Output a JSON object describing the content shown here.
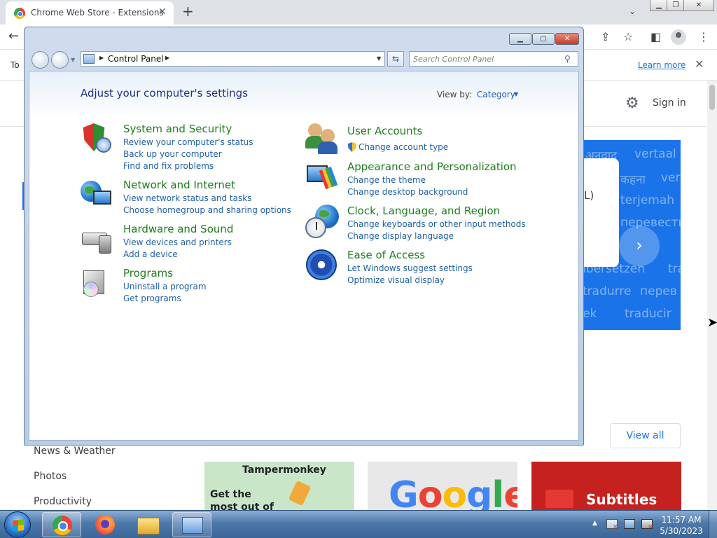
{
  "browser": {
    "tab_title": "Chrome Web Store - Extensions",
    "tab_close": "✕",
    "new_tab": "+",
    "infobar_text": "To",
    "learn_more": "Learn more",
    "sign_in": "Sign in",
    "banner_words": [
      "अनुवाद",
      "vertaal",
      "कहना",
      "ver",
      "terjemah",
      "перевести",
      "ubersetzen",
      "tra",
      "tradurre",
      "перев",
      "ek",
      "traducir"
    ],
    "banner_card_text": "L)",
    "sidebar_items": [
      "News & Weather",
      "Photos",
      "Productivity"
    ],
    "view_all": "View all",
    "tiles": {
      "tampermonkey_title": "Tampermonkey",
      "tampermonkey_sub": "Get the most out of every",
      "google_logo": "Google",
      "subtitles_title": "Subtitles"
    }
  },
  "control_panel": {
    "address_text": "Control Panel",
    "search_placeholder": "Search Control Panel",
    "heading": "Adjust your computer's settings",
    "view_by_label": "View by:",
    "view_by_value": "Category",
    "categories_left": [
      {
        "title": "System and Security",
        "links": [
          "Review your computer's status",
          "Back up your computer",
          "Find and fix problems"
        ]
      },
      {
        "title": "Network and Internet",
        "links": [
          "View network status and tasks",
          "Choose homegroup and sharing options"
        ]
      },
      {
        "title": "Hardware and Sound",
        "links": [
          "View devices and printers",
          "Add a device"
        ]
      },
      {
        "title": "Programs",
        "links": [
          "Uninstall a program",
          "Get programs"
        ]
      }
    ],
    "categories_right": [
      {
        "title": "User Accounts",
        "links": [
          "Change account type"
        ]
      },
      {
        "title": "Appearance and Personalization",
        "links": [
          "Change the theme",
          "Change desktop background"
        ]
      },
      {
        "title": "Clock, Language, and Region",
        "links": [
          "Change keyboards or other input methods",
          "Change display language"
        ]
      },
      {
        "title": "Ease of Access",
        "links": [
          "Let Windows suggest settings",
          "Optimize visual display"
        ]
      }
    ]
  },
  "taskbar": {
    "time": "11:57 AM",
    "date": "5/30/2023"
  },
  "colors": {
    "cp_category_title": "#1e7d1e",
    "cp_link": "#1f5fa8",
    "cp_heading": "#1e3287",
    "chrome_link": "#1a73e8",
    "banner": "#1a73e8"
  }
}
